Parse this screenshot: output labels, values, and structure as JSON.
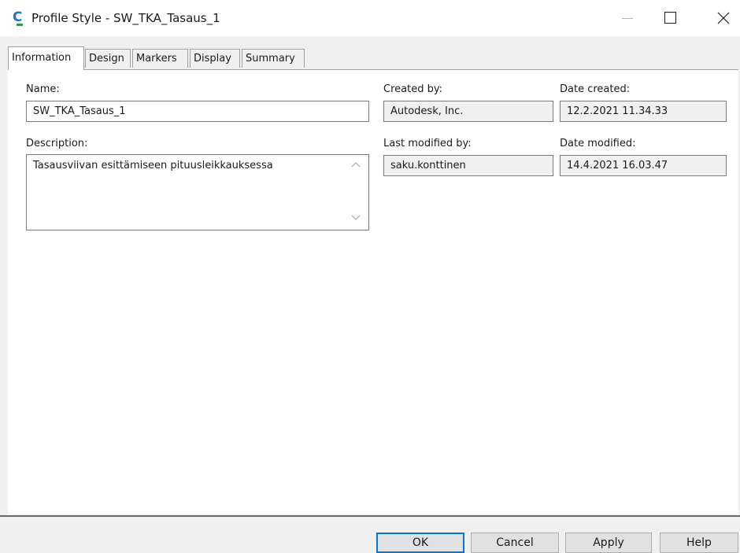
{
  "window": {
    "title": "Profile Style - SW_TKA_Tasaus_1",
    "icon": "civil3d-app-icon"
  },
  "tabs": [
    {
      "label": "Information",
      "active": true
    },
    {
      "label": "Design",
      "active": false
    },
    {
      "label": "Markers",
      "active": false
    },
    {
      "label": "Display",
      "active": false
    },
    {
      "label": "Summary",
      "active": false
    }
  ],
  "info": {
    "name_label": "Name:",
    "name_value": "SW_TKA_Tasaus_1",
    "description_label": "Description:",
    "description_value": "Tasausviivan esittämiseen pituusleikkauksessa",
    "created_by_label": "Created by:",
    "created_by_value": "Autodesk, Inc.",
    "date_created_label": "Date created:",
    "date_created_value": "12.2.2021 11.34.33",
    "last_modified_by_label": "Last modified by:",
    "last_modified_by_value": "saku.konttinen",
    "date_modified_label": "Date modified:",
    "date_modified_value": "14.4.2021 16.03.47"
  },
  "buttons": {
    "ok": "OK",
    "cancel": "Cancel",
    "apply": "Apply",
    "help": "Help"
  },
  "colors": {
    "accent": "#0078d7",
    "icon_blue": "#1e73c8",
    "icon_green": "#2e9a4a"
  }
}
